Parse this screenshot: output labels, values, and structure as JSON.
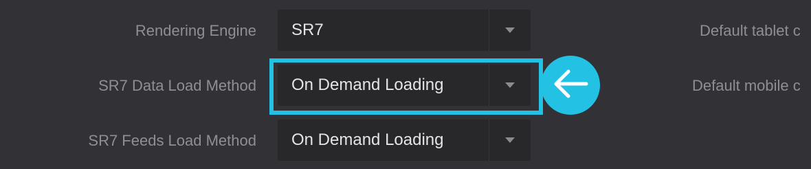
{
  "settings": {
    "rows": [
      {
        "label": "Rendering Engine",
        "value": "SR7"
      },
      {
        "label": "SR7 Data Load Method",
        "value": "On Demand Loading"
      },
      {
        "label": "SR7 Feeds Load Method",
        "value": "On Demand Loading"
      }
    ],
    "right_labels": [
      "Default tablet c",
      "Default mobile c"
    ]
  },
  "annotation": {
    "highlight_color": "#23c2e5",
    "callout_icon": "arrow-left-icon"
  },
  "colors": {
    "background": "#323236",
    "select_background": "#28282b",
    "label_text": "#8f8f93",
    "value_text": "#e4e4e6",
    "accent": "#23c2e5"
  }
}
